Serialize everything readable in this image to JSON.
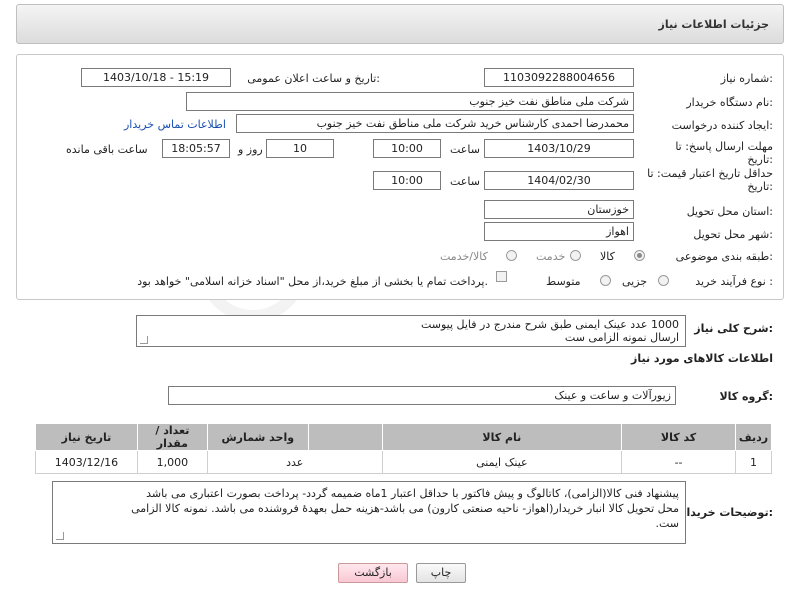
{
  "header": {
    "title": "جزئیات اطلاعات نیاز"
  },
  "form": {
    "need_number_label": "شماره نیاز:",
    "need_number": "1103092288004656",
    "announce_label": "تاریخ و ساعت اعلان عمومی:",
    "announce_value": "1403/10/18 - 15:19",
    "buyer_org_label": "نام دستگاه خریدار:",
    "buyer_org": "شرکت ملی مناطق نفت خیز جنوب",
    "requester_label": "ایجاد کننده درخواست:",
    "requester": "محمدرضا احمدی  کارشناس خرید  شرکت ملی مناطق نفت خیز جنوب",
    "contact_link": "اطلاعات تماس خریدار",
    "deadline_label": "مهلت ارسال پاسخ: تا",
    "deadline_label2": "تاریخ:",
    "deadline_date": "1403/10/29",
    "time_label": "ساعت",
    "deadline_time": "10:00",
    "days_value": "10",
    "days_label": "روز و",
    "remaining_time": "18:05:57",
    "remaining_label": "ساعت باقی مانده",
    "validity_label": "حداقل تاریخ اعتبار قیمت: تا",
    "validity_label2": "تاریخ:",
    "validity_date": "1404/02/30",
    "validity_time_label": "ساعت",
    "validity_time": "10:00",
    "province_label": "استان محل تحویل:",
    "province": "خوزستان",
    "city_label": "شهر محل تحویل:",
    "city": "اهواز",
    "category_label": "طبقه بندی موضوعی:",
    "category_options": [
      "کالا",
      "خدمت",
      "کالا/خدمت"
    ],
    "category_selected": "کالا",
    "process_label": "نوع فرآیند خرید :",
    "process_options": [
      "جزیی",
      "متوسط"
    ],
    "process_selected": "جزیی",
    "payment_note": "پرداخت تمام یا بخشی از مبلغ خرید،از محل \"اسناد خزانه اسلامی\" خواهد بود."
  },
  "description": {
    "label": "شرح کلی نیاز:",
    "text": "1000 عدد عینک ایمنی طبق شرح مندرج در فایل پیوست\nارسال نمونه الزامی ست"
  },
  "goods_info": {
    "title": "اطلاعات کالاهای مورد نیاز",
    "group_label": "گروه کالا:",
    "group_value": "زیورآلات و ساعت و عینک"
  },
  "table": {
    "headers": [
      "ردیف",
      "کد کالا",
      "نام کالا",
      "واحد شمارش",
      "تعداد / مقدار",
      "تاریخ نیاز"
    ],
    "rows": [
      [
        "1",
        "--",
        "عینک ایمنی",
        "عدد",
        "1,000",
        "1403/12/16"
      ]
    ]
  },
  "buyer_notes": {
    "label": "توضیحات خریدار:",
    "text": "پیشنهاد فنی کالا(الزامی)، کاتالوگ و پیش فاکتور با حداقل اعتبار 1ماه ضمیمه گردد- پرداخت بصورت اعتباری می باشد\nمحل تحویل کالا انبار خریدار(اهواز- ناحیه صنعتی کارون) می باشد-هزینه حمل بعهدهٔ فروشنده می باشد. نمونه کالا الزامی\nست."
  },
  "buttons": {
    "print": "چاپ",
    "back": "بازگشت"
  },
  "watermark": {
    "text": "AriaTender.neT"
  }
}
